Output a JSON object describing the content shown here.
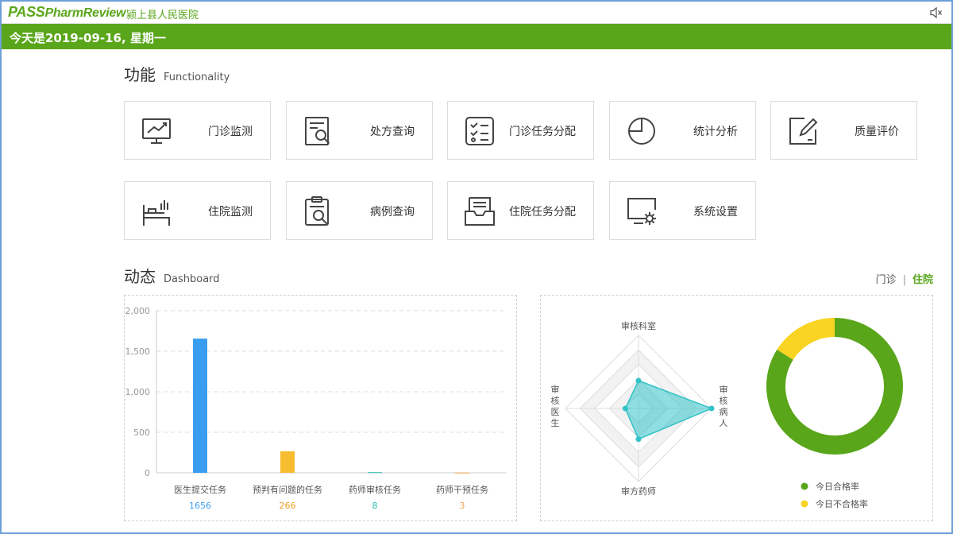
{
  "header": {
    "logo_pass": "PASS",
    "logo_rest": "PharmReview",
    "hospital": "颍上县人民医院",
    "date_text": "今天是2019-09-16, 星期一"
  },
  "functionality": {
    "title": "功能",
    "subtitle": "Functionality",
    "cards": [
      {
        "label": "门诊监测",
        "icon": "monitor-chart-icon"
      },
      {
        "label": "处方查询",
        "icon": "prescription-search-icon"
      },
      {
        "label": "门诊任务分配",
        "icon": "checklist-icon"
      },
      {
        "label": "统计分析",
        "icon": "pie-chart-icon"
      },
      {
        "label": "质量评价",
        "icon": "edit-square-icon"
      },
      {
        "label": "住院监测",
        "icon": "hospital-bed-icon"
      },
      {
        "label": "病例查询",
        "icon": "clipboard-search-icon"
      },
      {
        "label": "住院任务分配",
        "icon": "inbox-tray-icon"
      },
      {
        "label": "系统设置",
        "icon": "monitor-gear-icon"
      }
    ]
  },
  "dashboard": {
    "title": "动态",
    "subtitle": "Dashboard",
    "toggle_outpatient": "门诊",
    "toggle_separator": "|",
    "toggle_inpatient": "住院"
  },
  "colors": {
    "brand_green": "#5aa61b",
    "bar_blue": "#3a9ef0",
    "bar_yellow": "#f7bc2f",
    "bar_teal": "#2bbfae",
    "bar_orange": "#f0a04a",
    "radar_fill": "#33c2c8",
    "donut_pass": "#5aa61b",
    "donut_fail": "#f9d422"
  },
  "chart_data": [
    {
      "type": "bar",
      "categories": [
        "医生提交任务",
        "预判有问题的任务",
        "药师审核任务",
        "药师干预任务"
      ],
      "values": [
        1656,
        266,
        8,
        3
      ],
      "value_labels": [
        "1656",
        "266",
        "8",
        "3"
      ],
      "ylim": [
        0,
        2000
      ],
      "yticks": [
        0,
        500,
        1000,
        1500,
        2000
      ],
      "ytick_labels": [
        "0",
        "500",
        "1,000",
        "1,500",
        "2,000"
      ],
      "grid": true
    },
    {
      "type": "radar",
      "indicators": [
        "审核科室",
        "审核病人",
        "审方药师",
        "审核医生"
      ],
      "values": [
        0.38,
        1.0,
        0.42,
        0.18
      ],
      "max": 1.0
    },
    {
      "type": "pie",
      "labels": [
        "今日合格率",
        "今日不合格率"
      ],
      "values": [
        84,
        16
      ],
      "legend": "bottom"
    }
  ]
}
